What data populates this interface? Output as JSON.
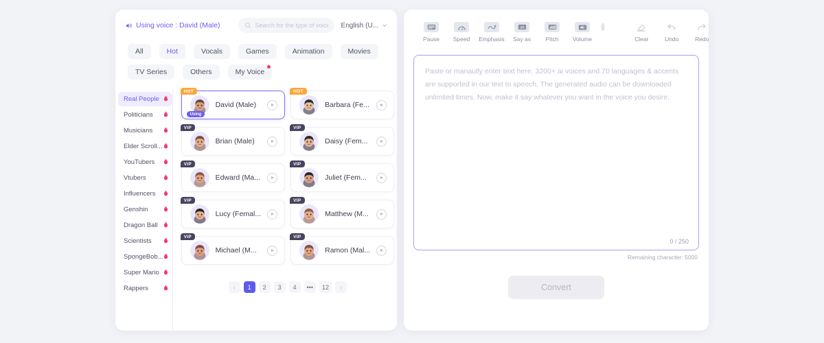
{
  "left_panel": {
    "using_voice_label": "Using voice : David (Male)",
    "search": {
      "placeholder": "Search for the type of voice you ...",
      "value": ""
    },
    "language": {
      "selected": "English (U..."
    },
    "tags": [
      {
        "label": "All",
        "active": false,
        "dot": false
      },
      {
        "label": "Hot",
        "active": true,
        "dot": false
      },
      {
        "label": "Vocals",
        "active": false,
        "dot": false
      },
      {
        "label": "Games",
        "active": false,
        "dot": false
      },
      {
        "label": "Animation",
        "active": false,
        "dot": false
      },
      {
        "label": "Movies",
        "active": false,
        "dot": false
      },
      {
        "label": "TV Series",
        "active": false,
        "dot": false
      },
      {
        "label": "Others",
        "active": false,
        "dot": false
      },
      {
        "label": "My Voice",
        "active": false,
        "dot": true
      }
    ],
    "categories": [
      {
        "label": "Real People",
        "active": true
      },
      {
        "label": "Politicians",
        "active": false
      },
      {
        "label": "Musicians",
        "active": false
      },
      {
        "label": "Elder Scroll...",
        "active": false
      },
      {
        "label": "YouTubers",
        "active": false
      },
      {
        "label": "Vtubers",
        "active": false
      },
      {
        "label": "Influencers",
        "active": false
      },
      {
        "label": "Genshin",
        "active": false
      },
      {
        "label": "Dragon Ball",
        "active": false
      },
      {
        "label": "Scientists",
        "active": false
      },
      {
        "label": "SpongeBob...",
        "active": false
      },
      {
        "label": "Super Mario",
        "active": false
      },
      {
        "label": "Rappers",
        "active": false
      }
    ],
    "voices": [
      {
        "name": "David (Male)",
        "badge": "HOT",
        "badge_type": "hot",
        "selected": true,
        "using_label": "Using",
        "skin": "#d9a07e",
        "hair": "#6f4b3a"
      },
      {
        "name": "Barbara (Fe...",
        "badge": "HOT",
        "badge_type": "hot",
        "selected": false,
        "using_label": "",
        "skin": "#e8c0a6",
        "hair": "#2f2a2e"
      },
      {
        "name": "Brian (Male)",
        "badge": "VIP",
        "badge_type": "vip",
        "selected": false,
        "using_label": "",
        "skin": "#e0ae86",
        "hair": "#7a4f3c"
      },
      {
        "name": "Daisy (Fem...",
        "badge": "VIP",
        "badge_type": "vip",
        "selected": false,
        "using_label": "",
        "skin": "#e2b596",
        "hair": "#30272b"
      },
      {
        "name": "Edward (Ma...",
        "badge": "VIP",
        "badge_type": "vip",
        "selected": false,
        "using_label": "",
        "skin": "#dca583",
        "hair": "#8a5a49"
      },
      {
        "name": "Juliet (Fem...",
        "badge": "VIP",
        "badge_type": "vip",
        "selected": false,
        "using_label": "",
        "skin": "#d8a486",
        "hair": "#2c2529"
      },
      {
        "name": "Lucy (Femal...",
        "badge": "VIP",
        "badge_type": "vip",
        "selected": false,
        "using_label": "",
        "skin": "#e3b393",
        "hair": "#2b2327"
      },
      {
        "name": "Matthew (M...",
        "badge": "VIP",
        "badge_type": "vip",
        "selected": false,
        "using_label": "",
        "skin": "#e6b189",
        "hair": "#8f5c48"
      },
      {
        "name": "Michael (M...",
        "badge": "VIP",
        "badge_type": "vip",
        "selected": false,
        "using_label": "",
        "skin": "#dca07c",
        "hair": "#7c4f3f"
      },
      {
        "name": "Ramon (Mal...",
        "badge": "VIP",
        "badge_type": "vip",
        "selected": false,
        "using_label": "",
        "skin": "#e0a57f",
        "hair": "#7e5140"
      }
    ],
    "pagination": {
      "prev": "‹",
      "next": "›",
      "pages": [
        "1",
        "2",
        "3",
        "4",
        "•••",
        "12"
      ],
      "current": "1"
    }
  },
  "right_panel": {
    "tools": [
      {
        "label": "Pause",
        "icon": "pause-lines-icon"
      },
      {
        "label": "Speed",
        "icon": "speedometer-icon"
      },
      {
        "label": "Emphasis",
        "icon": "emphasis-wave-icon"
      },
      {
        "label": "Say as",
        "icon": "say-as-icon"
      },
      {
        "label": "Pitch",
        "icon": "pitch-bars-icon"
      },
      {
        "label": "Volume",
        "icon": "volume-icon"
      }
    ],
    "info_glyph": "i",
    "actions": [
      {
        "label": "Clear",
        "icon": "eraser-icon"
      },
      {
        "label": "Undo",
        "icon": "undo-arrow-icon"
      },
      {
        "label": "Redo",
        "icon": "redo-arrow-icon"
      }
    ],
    "editor": {
      "placeholder": "Paste or manaully enter text here. 3200+ ai voices and 70 languages & accents are supported in our text to speech. The generated audio can be downloaded unlimited times. Now, make it say whatever you want in the voice you desire.",
      "value": "",
      "counter": "0 / 250",
      "remaining": "Remaining character: 5000"
    },
    "convert_label": "Convert"
  },
  "colors": {
    "accent": "#6b5df0",
    "page_active": "#5b5bf0",
    "hot_badge": "#ffa53a",
    "vip_badge": "#474460",
    "dot": "#f9356e",
    "background": "#f2f3f7"
  }
}
